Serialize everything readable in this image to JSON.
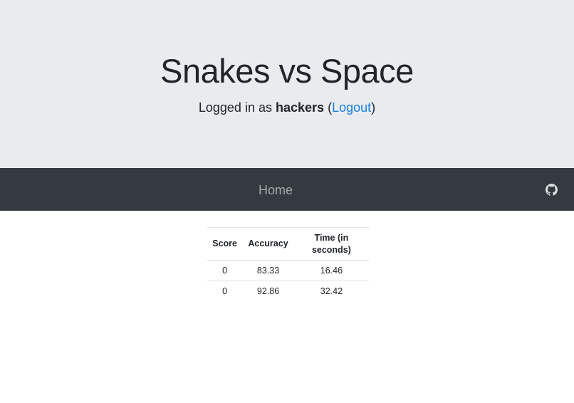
{
  "header": {
    "title": "Snakes vs Space",
    "login_prefix": "Logged in as",
    "username": "hackers",
    "open_paren": "(",
    "logout_label": "Logout",
    "close_paren": ")"
  },
  "navbar": {
    "home_label": "Home",
    "github_icon": "github-icon"
  },
  "table": {
    "columns": [
      "Score",
      "Accuracy",
      "Time (in seconds)"
    ],
    "rows": [
      [
        "0",
        "83.33",
        "16.46"
      ],
      [
        "0",
        "92.86",
        "32.42"
      ]
    ]
  },
  "colors": {
    "jumbotron_bg": "#e9ecef",
    "navbar_bg": "#343a40",
    "link": "#1a7fe0"
  }
}
